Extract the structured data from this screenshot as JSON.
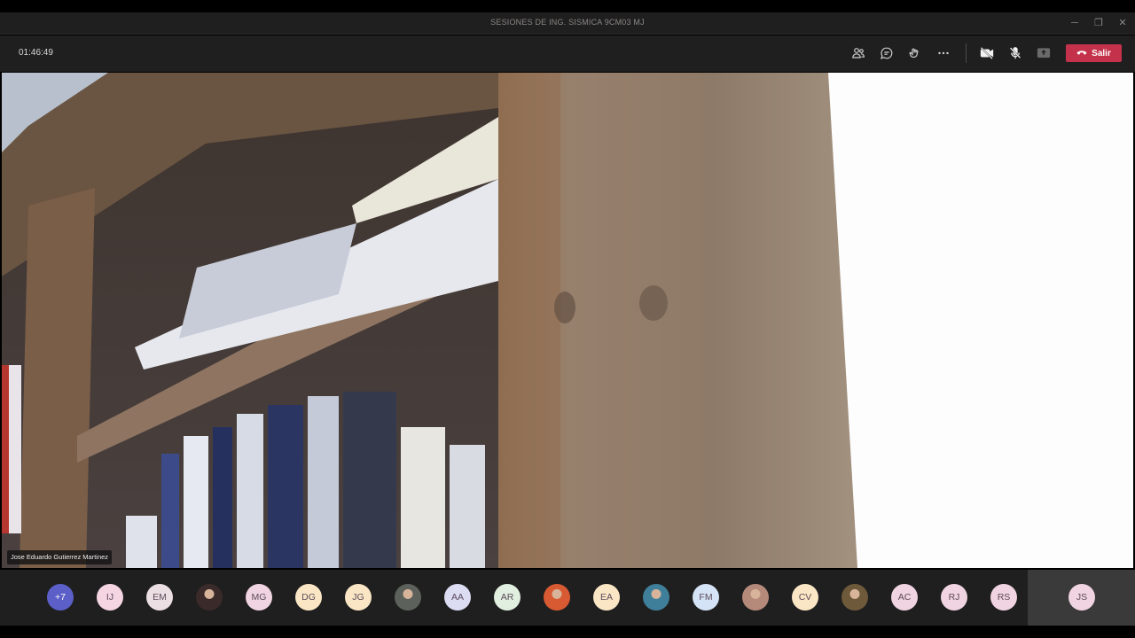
{
  "window": {
    "title": "SESIONES DE ING. SISMICA 9CM03 MJ",
    "minimize_glyph": "─",
    "restore_glyph": "❐",
    "close_glyph": "✕"
  },
  "toolbar": {
    "elapsed": "01:46:49",
    "leave_label": "Salir",
    "icons": [
      "participants-icon",
      "chat-icon",
      "reactions-icon",
      "more-icon",
      "camera-off-icon",
      "mic-off-icon",
      "share-icon",
      "phone-hangup-icon"
    ],
    "leave_color": "#c4314b"
  },
  "video": {
    "speaker_name": "Jose Eduardo Gutierrez Martinez"
  },
  "participants": [
    {
      "label": "+7",
      "type": "overflow",
      "color": "#5b5fc7"
    },
    {
      "label": "IJ",
      "color": "#f6d5e3"
    },
    {
      "label": "EM",
      "color": "#ecdfe3"
    },
    {
      "label": "",
      "type": "photo",
      "color": "#3b2a2a"
    },
    {
      "label": "MG",
      "color": "#f1d4e1"
    },
    {
      "label": "DG",
      "color": "#fae6c4"
    },
    {
      "label": "JG",
      "color": "#fae6c4"
    },
    {
      "label": "",
      "type": "photo",
      "color": "#5d615c"
    },
    {
      "label": "AA",
      "color": "#dcdcf3"
    },
    {
      "label": "AR",
      "color": "#e1efe0"
    },
    {
      "label": "",
      "type": "photo",
      "color": "#d75a32"
    },
    {
      "label": "EA",
      "color": "#fae6c4"
    },
    {
      "label": "",
      "type": "photo",
      "color": "#3f7f9a"
    },
    {
      "label": "FM",
      "color": "#d5e3f6"
    },
    {
      "label": "",
      "type": "photo",
      "color": "#b58a7a"
    },
    {
      "label": "CV",
      "color": "#fae6c4"
    },
    {
      "label": "",
      "type": "photo",
      "color": "#6e5a3a"
    },
    {
      "label": "AC",
      "color": "#f1d4e1"
    },
    {
      "label": "RJ",
      "color": "#f1d4e1"
    },
    {
      "label": "RS",
      "color": "#f1d4e1"
    }
  ],
  "self": {
    "label": "JS",
    "color": "#f1d4e1"
  }
}
